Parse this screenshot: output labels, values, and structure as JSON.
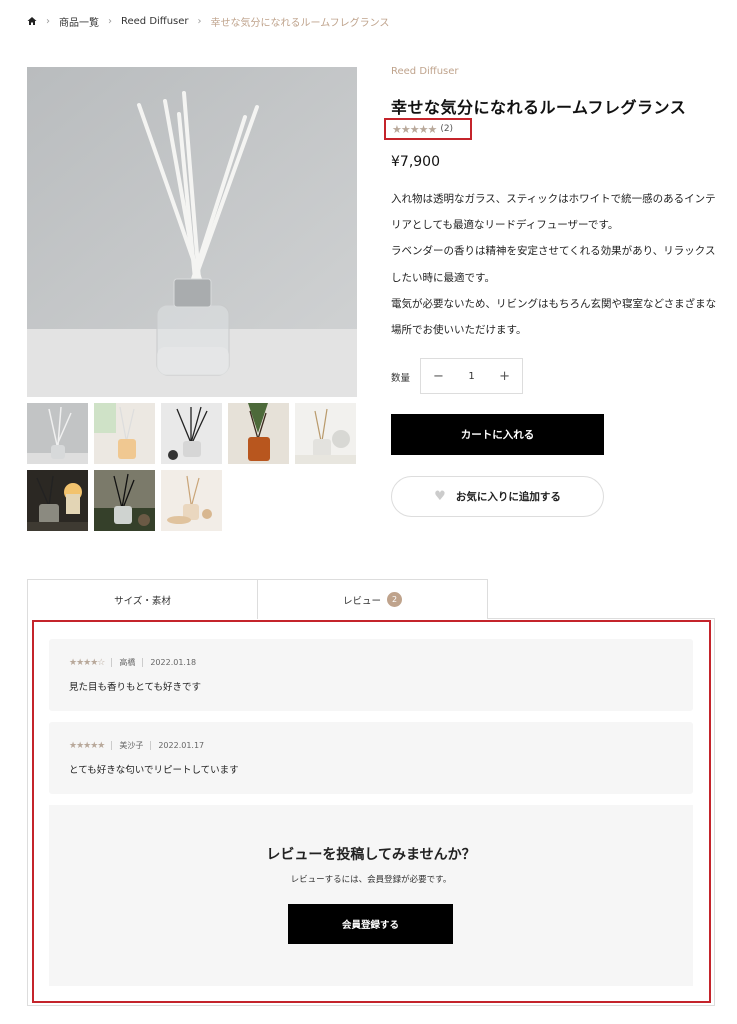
{
  "breadcrumb": {
    "items": [
      "商品一覧",
      "Reed Diffuser"
    ],
    "current": "幸せな気分になれるルームフレグランス"
  },
  "product": {
    "brand": "Reed Diffuser",
    "title": "幸せな気分になれるルームフレグランス",
    "rating_stars": "★★★★★",
    "rating_value": 4.5,
    "rating_count": "(2)",
    "price": "¥7,900",
    "description": [
      "入れ物は透明なガラス、スティックはホワイトで統一感のあるインテリアとしても最適なリードディフューザーです。",
      "ラベンダーの香りは精神を安定させてくれる効果があり、リラックスしたい時に最適です。",
      "電気が必要ないため、リビングはもちろん玄関や寝室などさまざまな場所でお使いいただけます。"
    ],
    "quantity_label": "数量",
    "quantity_value": "1",
    "minus_symbol": "−",
    "plus_symbol": "+",
    "cart_button": "カートに入れる",
    "favorite_button": "お気に入りに追加する"
  },
  "tabs": [
    {
      "label": "サイズ・素材"
    },
    {
      "label": "レビュー",
      "badge": "2"
    }
  ],
  "reviews": [
    {
      "stars": "★★★★☆",
      "rating": 4,
      "author": "高橋",
      "date": "2022.01.18",
      "text": "見た目も香りもとても好きです"
    },
    {
      "stars": "★★★★★",
      "rating": 5,
      "author": "美沙子",
      "date": "2022.01.17",
      "text": "とても好きな匂いでリピートしています"
    }
  ],
  "cta": {
    "title": "レビューを投稿してみませんか？",
    "subtitle": "レビューするには、会員登録が必要です。",
    "button": "会員登録する"
  },
  "colors": {
    "accent": "#bfa38c",
    "highlight_frame": "#c4242b",
    "button_bg": "#000000"
  },
  "icons": [
    "home-icon",
    "chevron-right-icon",
    "star-icon",
    "minus-icon",
    "plus-icon",
    "heart-icon"
  ]
}
